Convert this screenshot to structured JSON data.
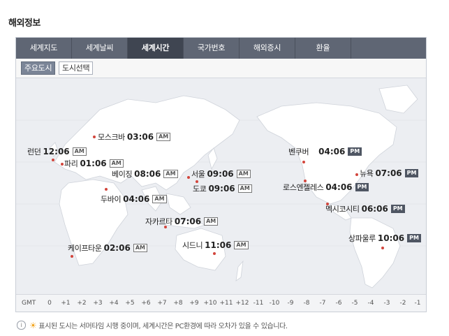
{
  "page_title": "해외정보",
  "tabs": [
    {
      "label": "세계지도"
    },
    {
      "label": "세계날씨"
    },
    {
      "label": "세계시간"
    },
    {
      "label": "국가번호"
    },
    {
      "label": "해외증시"
    },
    {
      "label": "환율"
    }
  ],
  "active_tab": "세계시간",
  "subnav": {
    "major_cities": "주요도시",
    "select_city": "도시선택"
  },
  "cities": [
    {
      "name": "모스크바",
      "time": "03:06",
      "ampm": "AM"
    },
    {
      "name": "런던",
      "time": "12:06",
      "ampm": "AM"
    },
    {
      "name": "파리",
      "time": "01:06",
      "ampm": "AM"
    },
    {
      "name": "베이징",
      "time": "08:06",
      "ampm": "AM"
    },
    {
      "name": "서울",
      "time": "09:06",
      "ampm": "AM"
    },
    {
      "name": "도쿄",
      "time": "09:06",
      "ampm": "AM"
    },
    {
      "name": "두바이",
      "time": "04:06",
      "ampm": "AM"
    },
    {
      "name": "자카르타",
      "time": "07:06",
      "ampm": "AM"
    },
    {
      "name": "시드니",
      "time": "11:06",
      "ampm": "AM"
    },
    {
      "name": "케이프타운",
      "time": "02:06",
      "ampm": "AM"
    },
    {
      "name": "벤쿠버",
      "time": "04:06",
      "ampm": "PM"
    },
    {
      "name": "뉴욕",
      "time": "07:06",
      "ampm": "PM"
    },
    {
      "name": "로스엔젤레스",
      "time": "04:06",
      "ampm": "PM"
    },
    {
      "name": "멕시코시티",
      "time": "06:06",
      "ampm": "PM"
    },
    {
      "name": "상파울루",
      "time": "10:06",
      "ampm": "PM"
    }
  ],
  "gmt": {
    "label": "GMT",
    "ticks": [
      "0",
      "+1",
      "+2",
      "+3",
      "+4",
      "+5",
      "+6",
      "+7",
      "+8",
      "+9",
      "+10",
      "+11",
      "+12",
      "-11",
      "-10",
      "-9",
      "-8",
      "-7",
      "-6",
      "-5",
      "-4",
      "-3",
      "-2",
      "-1"
    ]
  },
  "footnote": "표시된 도시는 서머타임 시행 중이며, 세계시간은 PC환경에 따라 오차가 있을 수 있습니다.",
  "icons": [
    "info-icon",
    "sun-icon"
  ],
  "colors": {
    "tab_bg": "#5f6674",
    "tab_active": "#3f4551",
    "city_dot": "#d2453c",
    "map_bg": "#eceef2"
  }
}
